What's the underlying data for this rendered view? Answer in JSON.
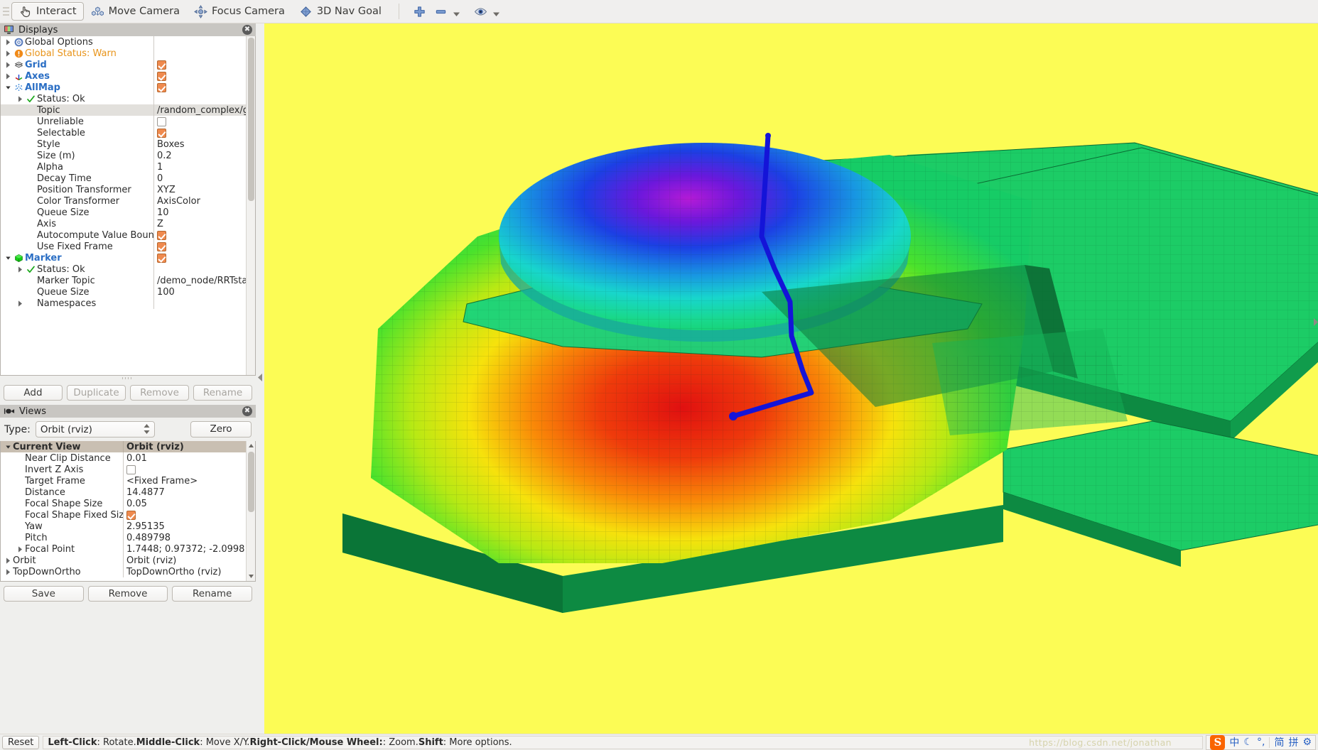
{
  "toolbar": {
    "buttons": [
      {
        "label": "Interact",
        "icon": "hand-cursor-icon",
        "active": true
      },
      {
        "label": "Move Camera",
        "icon": "move-camera-icon",
        "active": false
      },
      {
        "label": "Focus Camera",
        "icon": "focus-camera-icon",
        "active": false
      },
      {
        "label": "3D Nav Goal",
        "icon": "nav-goal-diamond-icon",
        "active": false
      }
    ],
    "icon_buttons": [
      {
        "name": "plus-icon"
      },
      {
        "name": "minus-icon"
      },
      {
        "name": "chevron-down-icon"
      },
      {
        "name": "eye-icon"
      },
      {
        "name": "chevron-down-icon"
      }
    ]
  },
  "displays": {
    "title": "Displays",
    "title_icon": "display-monitor-icon",
    "close_label": "✖",
    "rows": [
      {
        "indent": 0,
        "twisty": "right",
        "icon": "gear-icon",
        "label": "Global Options",
        "style": "plain",
        "value_type": "none"
      },
      {
        "indent": 0,
        "twisty": "right",
        "icon": "warning-icon",
        "label": "Global Status: Warn",
        "style": "warn",
        "value_type": "none"
      },
      {
        "indent": 0,
        "twisty": "right",
        "icon": "grid-icon",
        "label": "Grid",
        "style": "bluebold",
        "value_type": "check",
        "value": true
      },
      {
        "indent": 0,
        "twisty": "right",
        "icon": "axes-icon",
        "label": "Axes",
        "style": "bluebold",
        "value_type": "check",
        "value": true
      },
      {
        "indent": 0,
        "twisty": "down",
        "icon": "pointcloud-icon",
        "label": "AllMap",
        "style": "bluebold",
        "value_type": "check",
        "value": true
      },
      {
        "indent": 1,
        "twisty": "right",
        "icon": "check-green-icon",
        "label": "Status: Ok",
        "style": "plain",
        "value_type": "none"
      },
      {
        "indent": 1,
        "twisty": "none",
        "icon": "none",
        "label": "Topic",
        "style": "plain",
        "value_type": "text",
        "value": "/random_complex/gl...",
        "selected": true
      },
      {
        "indent": 1,
        "twisty": "none",
        "icon": "none",
        "label": "Unreliable",
        "style": "plain",
        "value_type": "check",
        "value": false
      },
      {
        "indent": 1,
        "twisty": "none",
        "icon": "none",
        "label": "Selectable",
        "style": "plain",
        "value_type": "check",
        "value": true
      },
      {
        "indent": 1,
        "twisty": "none",
        "icon": "none",
        "label": "Style",
        "style": "plain",
        "value_type": "text",
        "value": "Boxes"
      },
      {
        "indent": 1,
        "twisty": "none",
        "icon": "none",
        "label": "Size (m)",
        "style": "plain",
        "value_type": "text",
        "value": "0.2"
      },
      {
        "indent": 1,
        "twisty": "none",
        "icon": "none",
        "label": "Alpha",
        "style": "plain",
        "value_type": "text",
        "value": "1"
      },
      {
        "indent": 1,
        "twisty": "none",
        "icon": "none",
        "label": "Decay Time",
        "style": "plain",
        "value_type": "text",
        "value": "0"
      },
      {
        "indent": 1,
        "twisty": "none",
        "icon": "none",
        "label": "Position Transformer",
        "style": "plain",
        "value_type": "text",
        "value": "XYZ"
      },
      {
        "indent": 1,
        "twisty": "none",
        "icon": "none",
        "label": "Color Transformer",
        "style": "plain",
        "value_type": "text",
        "value": "AxisColor"
      },
      {
        "indent": 1,
        "twisty": "none",
        "icon": "none",
        "label": "Queue Size",
        "style": "plain",
        "value_type": "text",
        "value": "10"
      },
      {
        "indent": 1,
        "twisty": "none",
        "icon": "none",
        "label": "Axis",
        "style": "plain",
        "value_type": "text",
        "value": "Z"
      },
      {
        "indent": 1,
        "twisty": "none",
        "icon": "none",
        "label": "Autocompute Value Bounds",
        "style": "plain",
        "value_type": "check",
        "value": true
      },
      {
        "indent": 1,
        "twisty": "none",
        "icon": "none",
        "label": "Use Fixed Frame",
        "style": "plain",
        "value_type": "check",
        "value": true
      },
      {
        "indent": 0,
        "twisty": "down",
        "icon": "marker-cube-icon",
        "label": "Marker",
        "style": "bluebold",
        "value_type": "check",
        "value": true
      },
      {
        "indent": 1,
        "twisty": "right",
        "icon": "check-green-icon",
        "label": "Status: Ok",
        "style": "plain",
        "value_type": "none"
      },
      {
        "indent": 1,
        "twisty": "none",
        "icon": "none",
        "label": "Marker Topic",
        "style": "plain",
        "value_type": "text",
        "value": "/demo_node/RRTsta..."
      },
      {
        "indent": 1,
        "twisty": "none",
        "icon": "none",
        "label": "Queue Size",
        "style": "plain",
        "value_type": "text",
        "value": "100"
      },
      {
        "indent": 1,
        "twisty": "right",
        "icon": "none",
        "label": "Namespaces",
        "style": "plain",
        "value_type": "none"
      }
    ],
    "buttons": [
      {
        "label": "Add",
        "enabled": true
      },
      {
        "label": "Duplicate",
        "enabled": false
      },
      {
        "label": "Remove",
        "enabled": false
      },
      {
        "label": "Rename",
        "enabled": false
      }
    ]
  },
  "views": {
    "title": "Views",
    "title_icon": "camera-icon",
    "close_label": "✖",
    "type_label": "Type:",
    "type_value": "Orbit (rviz)",
    "zero_label": "Zero",
    "rows": [
      {
        "indent": 0,
        "twisty": "down",
        "label": "Current View",
        "header": true,
        "value_type": "text",
        "value": "Orbit (rviz)"
      },
      {
        "indent": 1,
        "twisty": "none",
        "label": "Near Clip Distance",
        "value_type": "text",
        "value": "0.01"
      },
      {
        "indent": 1,
        "twisty": "none",
        "label": "Invert Z Axis",
        "value_type": "check",
        "value": false
      },
      {
        "indent": 1,
        "twisty": "none",
        "label": "Target Frame",
        "value_type": "text",
        "value": "<Fixed Frame>"
      },
      {
        "indent": 1,
        "twisty": "none",
        "label": "Distance",
        "value_type": "text",
        "value": "14.4877"
      },
      {
        "indent": 1,
        "twisty": "none",
        "label": "Focal Shape Size",
        "value_type": "text",
        "value": "0.05"
      },
      {
        "indent": 1,
        "twisty": "none",
        "label": "Focal Shape Fixed Size",
        "value_type": "check",
        "value": true
      },
      {
        "indent": 1,
        "twisty": "none",
        "label": "Yaw",
        "value_type": "text",
        "value": "2.95135"
      },
      {
        "indent": 1,
        "twisty": "none",
        "label": "Pitch",
        "value_type": "text",
        "value": "0.489798"
      },
      {
        "indent": 1,
        "twisty": "right",
        "label": "Focal Point",
        "value_type": "text",
        "value": "1.7448; 0.97372; -2.0998"
      },
      {
        "indent": 0,
        "twisty": "right",
        "label": "Orbit",
        "value_type": "text",
        "value": "Orbit (rviz)"
      },
      {
        "indent": 0,
        "twisty": "right",
        "label": "TopDownOrtho",
        "value_type": "text",
        "value": "TopDownOrtho (rviz)"
      }
    ],
    "buttons": [
      {
        "label": "Save",
        "enabled": true
      },
      {
        "label": "Remove",
        "enabled": true
      },
      {
        "label": "Rename",
        "enabled": true
      }
    ]
  },
  "statusbar": {
    "reset_label": "Reset",
    "hints": [
      {
        "bold": "Left-Click",
        "text": ": Rotate. "
      },
      {
        "bold": "Middle-Click",
        "text": ": Move X/Y. "
      },
      {
        "bold": "Right-Click/Mouse Wheel:",
        "text": ": Zoom. "
      },
      {
        "bold": "Shift",
        "text": ": More options."
      }
    ],
    "watermark": "https://blog.csdn.net/jonathan",
    "ime": {
      "logo": "S",
      "items": [
        "中",
        "☾",
        "°,",
        "简",
        "拼"
      ],
      "gear": "⚙"
    }
  },
  "viewport": {
    "background_color": "#fcfc55",
    "ground_color": "#16cc66",
    "path_color": "#1414d8",
    "heightmap_note": "3D point cloud heightmap colored by Z axis (AxisColor): red low center, yellow/green mid, cyan/blue/magenta dome top"
  }
}
